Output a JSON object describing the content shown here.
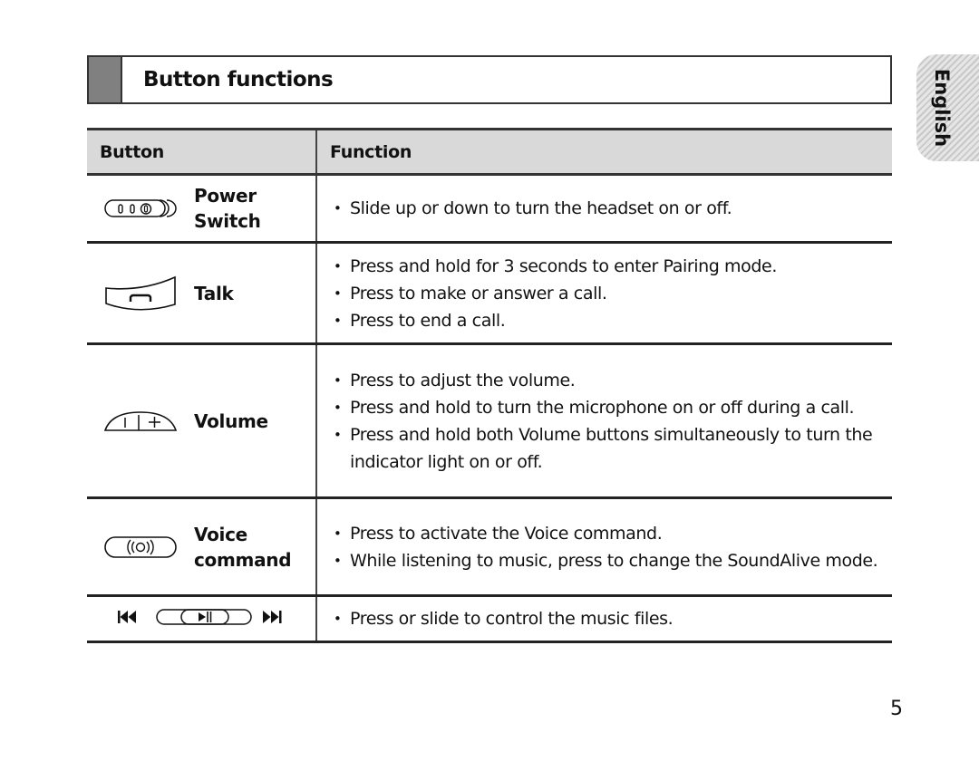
{
  "section": {
    "title": "Button functions"
  },
  "language_tab": {
    "label": "English"
  },
  "table": {
    "headers": {
      "button": "Button",
      "function": "Function"
    },
    "rows": [
      {
        "icon": "power-switch-icon",
        "button_lines": [
          "Power",
          "Switch"
        ],
        "functions": [
          "Slide up or down to turn the headset on or off."
        ]
      },
      {
        "icon": "talk-button-icon",
        "button_lines": [
          "Talk"
        ],
        "functions": [
          "Press and hold for 3 seconds to enter Pairing mode.",
          "Press to make or answer a call.",
          "Press to end a call."
        ]
      },
      {
        "icon": "volume-button-icon",
        "button_lines": [
          "Volume"
        ],
        "functions": [
          "Press to adjust the volume.",
          "Press and hold to turn the microphone on or off during a call.",
          "Press and hold both Volume buttons simultaneously to turn the indicator light on or off."
        ]
      },
      {
        "icon": "voice-command-icon",
        "button_lines": [
          "Voice",
          "command"
        ],
        "functions": [
          "Press to activate the Voice command.",
          "While listening to music, press to change the SoundAlive mode."
        ]
      },
      {
        "icon": "music-control-icon",
        "button_lines": [],
        "functions": [
          "Press or slide to control the music files."
        ]
      }
    ]
  },
  "page_number": "5"
}
